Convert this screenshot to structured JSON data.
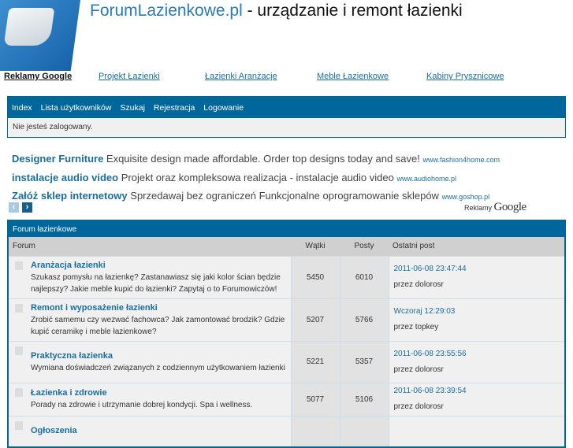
{
  "header": {
    "site_link": "ForumLazienkowe.pl",
    "tagline": " - urządzanie i remont łazienki"
  },
  "top_links": [
    "Reklamy Google",
    "Projekt Łazienki",
    "Łazienki Aranżacje",
    "Meble Łazienkowe",
    "Kabiny Prysznicowe"
  ],
  "nav": [
    "Index",
    "Lista użytkowników",
    "Szukaj",
    "Rejestracja",
    "Logowanie"
  ],
  "login_status": "Nie jesteś zalogowany.",
  "ads": [
    {
      "title": "Designer Furniture",
      "text": " Exquisite design made affordable. Order top designs today and save! ",
      "url": "www.fashion4home.com"
    },
    {
      "title": "instalacje audio video",
      "text": " Projekt oraz kompleksowa realizacja - instalacje audio video ",
      "url": "www.audiohome.pl"
    },
    {
      "title": "Załóż sklep internetowy",
      "text": " Sprzedawaj bez ograniczeń Funkcjonalne oprogramowanie sklepów ",
      "url": "www.goshop.pl"
    }
  ],
  "ads_label": "Reklamy ",
  "ads_brand": "Google",
  "forum": {
    "caption": "Forum łazienkowe",
    "headers": [
      "Forum",
      "Wątki",
      "Posty",
      "Ostatni post"
    ],
    "rows": [
      {
        "name": "Aranżacja łazienki",
        "desc": "Szukasz pomysłu na łazienkę? Zastanawiasz się jaki kolor ścian będzie najlepszy? Jakie meble kupić do łazienki? Zapytaj o to Forumowiczów!",
        "threads": "5450",
        "posts": "6010",
        "last": "2011-06-08 23:47:44",
        "by": "przez dolorosr"
      },
      {
        "name": "Remont i wyposażenie łazienki",
        "desc": "Zrobić samemu czy wezwać fachowca? Jak zamontować brodzik? Gdzie kupić ceramikę i meble łazienkowe?",
        "threads": "5207",
        "posts": "5766",
        "last": "Wczoraj 12:29:03",
        "by": "przez topkey"
      },
      {
        "name": "Praktyczna łazienka",
        "desc": "Wymiana doświadczeń związanych z codziennym użytkowaniem łazienki",
        "threads": "5221",
        "posts": "5357",
        "last": "2011-06-08 23:55:56",
        "by": "przez dolorosr"
      },
      {
        "name": "Łazienka i zdrowie",
        "desc": "Porady na zdrowie i utrzymanie dobrej kondycji. Spa i wellness.",
        "threads": "5077",
        "posts": "5106",
        "last": "2011-06-08 23:39:54",
        "by": "przez dolorosr"
      },
      {
        "name": "Ogłoszenia",
        "desc": "",
        "threads": "",
        "posts": "",
        "last": "",
        "by": ""
      }
    ]
  }
}
